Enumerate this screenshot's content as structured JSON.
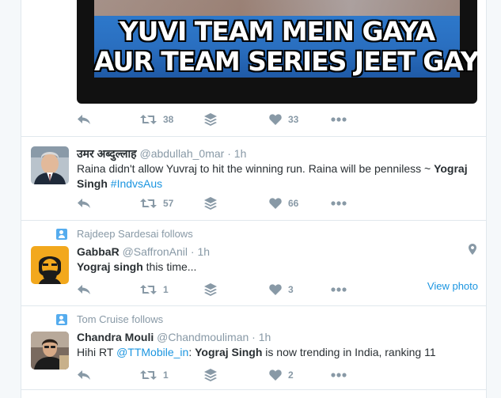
{
  "tweets": [
    {
      "media": {
        "line1": "YUVI TEAM MEIN GAYA",
        "line2": "AUR TEAM SERIES JEET GAYI!!"
      },
      "actions": {
        "retweets": "38",
        "likes": "33"
      }
    },
    {
      "fullname": "उमर अब्दुल्लाह",
      "handle": "@abdullah_0mar",
      "dot": "·",
      "time": "1h",
      "text_part1": "Raina didn't allow Yuvraj to hit the winning run. Raina will be penniless ~ ",
      "text_bold": "Yograj Singh",
      "hashtag": "#IndvsAus",
      "actions": {
        "retweets": "57",
        "likes": "66"
      }
    },
    {
      "context": "Rajdeep Sardesai follows",
      "fullname": "GabbaR",
      "handle": "@SaffronAnil",
      "dot": "·",
      "time": "1h",
      "text_bold": "Yograj singh",
      "text_rest": " this time...",
      "view_photo": "View photo",
      "actions": {
        "retweets": "1",
        "likes": "3"
      }
    },
    {
      "context": "Tom Cruise follows",
      "fullname": "Chandra Mouli",
      "handle": "@Chandmouliman",
      "dot": "·",
      "time": "1h",
      "text_part1": "Hihi RT ",
      "mention": "@TTMobile_in",
      "text_colon": ": ",
      "text_bold": "Yograj Singh",
      "text_rest": " is now trending in India, ranking 11",
      "actions": {
        "retweets": "1",
        "likes": "2"
      }
    }
  ],
  "colors": {
    "action_gray": "#8899a6",
    "link_blue": "#1b95e0",
    "follow_icon_blue": "#55acee",
    "border": "#e1e8ed"
  },
  "icons": [
    "reply-icon",
    "retweet-icon",
    "buffer-icon",
    "heart-icon",
    "more-icon",
    "person-icon",
    "location-pin-icon"
  ]
}
